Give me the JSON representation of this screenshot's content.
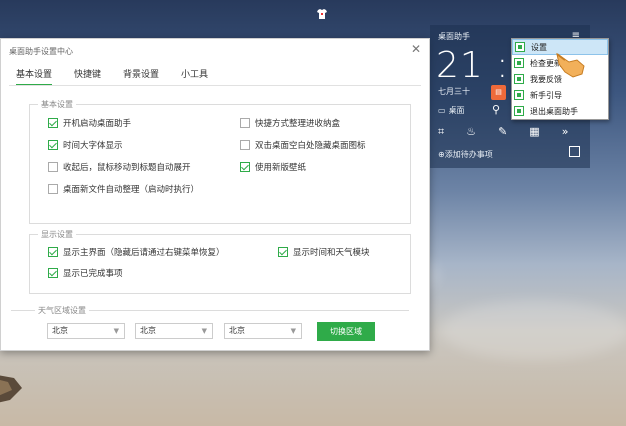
{
  "dialog": {
    "title": "桌面助手设置中心",
    "close_glyph": "✕",
    "tabs": [
      {
        "label": "基本设置"
      },
      {
        "label": "快捷键"
      },
      {
        "label": "背景设置"
      },
      {
        "label": "小工具"
      }
    ],
    "basic": {
      "title": "基本设置",
      "options": [
        {
          "label": "开机启动桌面助手",
          "checked": true
        },
        {
          "label": "快捷方式整理进收纳盒",
          "checked": false
        },
        {
          "label": "时间大字体显示",
          "checked": true
        },
        {
          "label": "双击桌面空白处隐藏桌面图标",
          "checked": false
        },
        {
          "label": "收起后，鼠标移动到标题自动展开",
          "checked": false
        },
        {
          "label": "使用新版壁纸",
          "checked": true
        },
        {
          "label": "桌面新文件自动整理（启动时执行）",
          "checked": false
        }
      ]
    },
    "display": {
      "title": "显示设置",
      "options": [
        {
          "label": "显示主界面（隐藏后请通过右键菜单恢复）",
          "checked": true
        },
        {
          "label": "显示时间和天气模块",
          "checked": true
        },
        {
          "label": "显示已完成事项",
          "checked": true
        }
      ]
    },
    "weather": {
      "title": "天气区域设置",
      "selects": [
        "北京",
        "北京",
        "北京"
      ],
      "switch_label": "切换区域"
    }
  },
  "widget": {
    "title": "桌面助手",
    "time": "21 : 2",
    "date": "七月三十",
    "desktop_label": "桌面",
    "orange_glyph": "▤",
    "todo_label": "添加待办事项",
    "icon_glyphs": [
      "⌗",
      "♨",
      "✎",
      "▦",
      "»"
    ]
  },
  "context_menu": {
    "items": [
      {
        "label": "设置"
      },
      {
        "label": "检查更新"
      },
      {
        "label": "我要反馈"
      },
      {
        "label": "新手引导"
      },
      {
        "label": "退出桌面助手"
      }
    ]
  },
  "colors": {
    "accent": "#2fab49",
    "highlight": "#cde6f7"
  }
}
